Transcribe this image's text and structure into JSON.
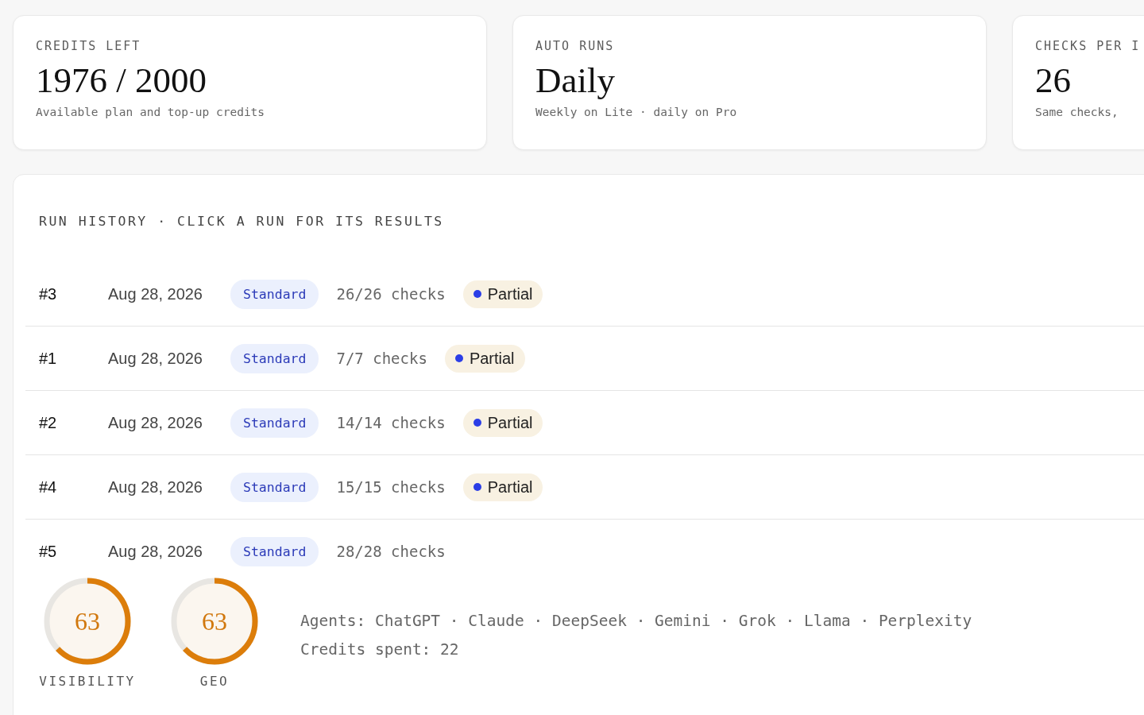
{
  "stat_cards": [
    {
      "label": "CREDITS LEFT",
      "value": "1976 / 2000",
      "note": "Available plan and top-up credits"
    },
    {
      "label": "AUTO RUNS",
      "value": "Daily",
      "note": "Weekly on Lite · daily on Pro"
    },
    {
      "label": "CHECKS PER I",
      "value": "26",
      "note": "Same checks,"
    }
  ],
  "run_history": {
    "title": "RUN HISTORY · CLICK A RUN FOR ITS RESULTS",
    "runs": [
      {
        "number": "#3",
        "date": "Aug 28, 2026",
        "tier": "Standard",
        "checks": "26/26 checks",
        "status": {
          "label": "Partial",
          "color": "#2b3ee6"
        },
        "expanded": false
      },
      {
        "number": "#1",
        "date": "Aug 28, 2026",
        "tier": "Standard",
        "checks": "7/7 checks",
        "status": {
          "label": "Partial",
          "color": "#2b3ee6"
        },
        "expanded": false
      },
      {
        "number": "#2",
        "date": "Aug 28, 2026",
        "tier": "Standard",
        "checks": "14/14 checks",
        "status": {
          "label": "Partial",
          "color": "#2b3ee6"
        },
        "expanded": false
      },
      {
        "number": "#4",
        "date": "Aug 28, 2026",
        "tier": "Standard",
        "checks": "15/15 checks",
        "status": {
          "label": "Partial",
          "color": "#2b3ee6"
        },
        "expanded": false
      },
      {
        "number": "#5",
        "date": "Aug 28, 2026",
        "tier": "Standard",
        "checks": "28/28 checks",
        "expanded": true,
        "details": {
          "scores": [
            {
              "value": "63",
              "label": "VISIBILITY",
              "level": 0.63
            },
            {
              "value": "63",
              "label": "GEO",
              "level": 0.63
            }
          ],
          "agents": "Agents: ChatGPT · Claude · DeepSeek · Gemini · Grok · Llama · Perplexity",
          "credits": "Credits spent: 22"
        }
      }
    ]
  }
}
